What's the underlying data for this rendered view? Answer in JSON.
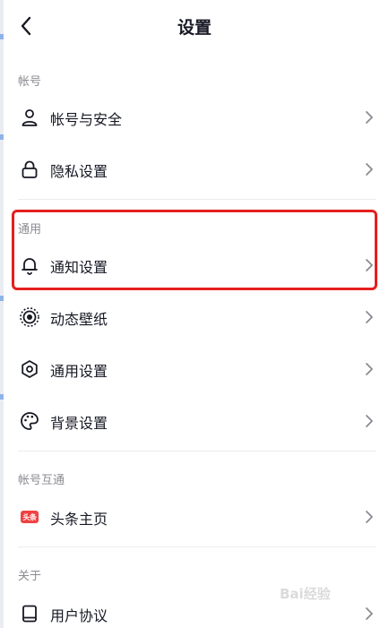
{
  "header": {
    "title": "设置",
    "back_icon": "chevron-left-icon"
  },
  "sections": {
    "account": {
      "label": "帐号"
    },
    "general": {
      "label": "通用"
    },
    "interop": {
      "label": "帐号互通"
    },
    "about": {
      "label": "关于"
    }
  },
  "items": {
    "account_security": {
      "label": "帐号与安全",
      "icon": "person-icon"
    },
    "privacy": {
      "label": "隐私设置",
      "icon": "lock-icon"
    },
    "notifications": {
      "label": "通知设置",
      "icon": "bell-icon"
    },
    "live_wallpaper": {
      "label": "动态壁纸",
      "icon": "concentric-circles-icon"
    },
    "general_settings": {
      "label": "通用设置",
      "icon": "gear-icon"
    },
    "background": {
      "label": "背景设置",
      "icon": "palette-icon"
    },
    "toutiao": {
      "label": "头条主页",
      "icon": "toutiao-badge-icon",
      "badge_text": "头条"
    },
    "user_agreement": {
      "label": "用户协议",
      "icon": "book-icon"
    }
  },
  "annotation": {
    "highlight_color": "#e4201e"
  },
  "watermark": {
    "text": "Bai经验"
  },
  "colors": {
    "text_primary": "#161823",
    "text_secondary": "#8a8b91",
    "divider": "#ececec",
    "badge_red": "#f04142"
  }
}
